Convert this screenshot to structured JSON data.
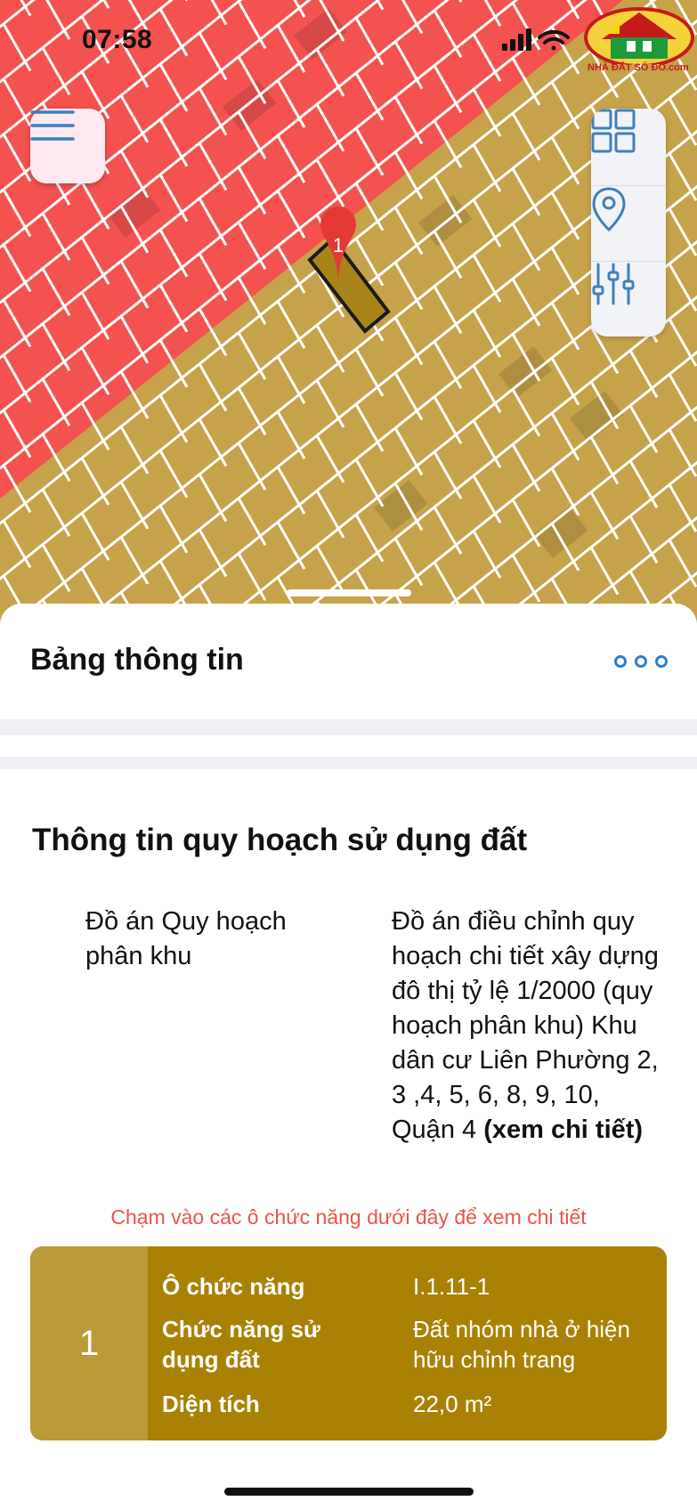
{
  "status_bar": {
    "time": "07:58"
  },
  "logo": {
    "text": "NHÀ ĐẤT SỔ ĐỎ.com"
  },
  "map": {
    "colors": {
      "residential_zone": "#c6a24a",
      "road_zone": "#f4524f",
      "parcel_lines": "#ffffff",
      "selected_outline": "#1a1a1a",
      "marker": "#e53935"
    },
    "marker_label": "1",
    "menu_icon": "hamburger-icon",
    "side_buttons": [
      {
        "icon": "grid-layers-icon"
      },
      {
        "icon": "location-pin-icon"
      },
      {
        "icon": "filter-sliders-icon"
      }
    ]
  },
  "sheet": {
    "title": "Bảng thông tin",
    "more_icon": "more-dots-icon",
    "section_title": "Thông tin quy hoạch sử dụng đất",
    "plan": {
      "label": "Đồ án Quy hoạch phân khu",
      "value": "Đồ án điều chỉnh quy hoạch chi tiết xây dựng đô thị tỷ lệ 1/2000 (quy hoạch phân khu) Khu dân cư Liên Phường 2, 3 ,4, 5, 6, 8, 9, 10, Quận 4",
      "link": "(xem chi tiết)"
    },
    "hint": "Chạm vào các ô chức năng dưới đây để xem chi tiết",
    "card": {
      "number": "1",
      "rows": [
        {
          "label": "Ô chức năng",
          "value": "I.1.11-1"
        },
        {
          "label": "Chức năng sử dụng đất",
          "value": "Đất nhóm nhà ở hiện hữu chỉnh trang"
        },
        {
          "label": "Diện tích",
          "value": "22,0 m²"
        }
      ],
      "colors": {
        "number_bg": "#b99a36",
        "body_bg": "#a98205",
        "text": "#ffffff"
      }
    }
  }
}
